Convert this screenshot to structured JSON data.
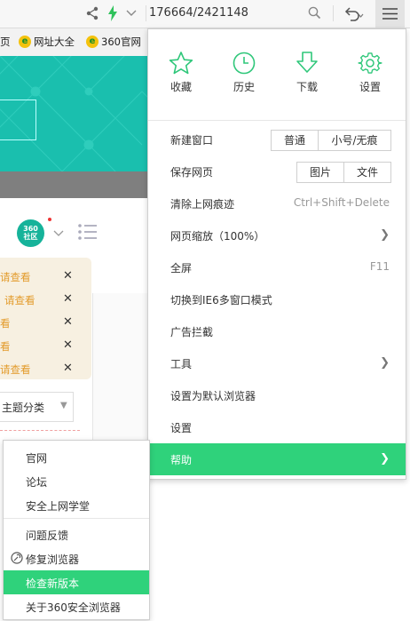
{
  "toolbar": {
    "address_text": "176664/2421148",
    "icons": [
      "share-icon",
      "lightning-icon",
      "chevron-down-icon",
      "search-icon",
      "undo-icon",
      "menu-icon"
    ]
  },
  "bookmarks": [
    {
      "label": "页"
    },
    {
      "label": "网址大全"
    },
    {
      "label": "360官网"
    }
  ],
  "page": {
    "badge_text": "360\n社区",
    "notices": [
      {
        "text": "请查看"
      },
      {
        "text": "请查看"
      },
      {
        "text": "看"
      },
      {
        "text": "看"
      },
      {
        "text": "请查看"
      }
    ],
    "theme_select": "主题分类",
    "accent_color": "#1abfae"
  },
  "menu": {
    "quick_actions": [
      {
        "label": "收藏",
        "icon": "star-icon"
      },
      {
        "label": "历史",
        "icon": "clock-icon"
      },
      {
        "label": "下载",
        "icon": "download-icon"
      },
      {
        "label": "设置",
        "icon": "gear-icon"
      }
    ],
    "items": [
      {
        "label": "新建窗口",
        "buttons": [
          "普通",
          "小号/无痕"
        ]
      },
      {
        "label": "保存网页",
        "buttons": [
          "图片",
          "文件"
        ]
      },
      {
        "label": "清除上网痕迹",
        "shortcut": "Ctrl+Shift+Delete"
      },
      {
        "label": "网页缩放（100%）",
        "has_submenu": true
      },
      {
        "label": "全屏",
        "shortcut": "F11"
      },
      {
        "label": "切换到IE6多窗口模式"
      },
      {
        "label": "广告拦截"
      },
      {
        "label": "工具",
        "has_submenu": true
      },
      {
        "label": "设置为默认浏览器"
      },
      {
        "label": "设置"
      },
      {
        "label": "帮助",
        "has_submenu": true,
        "highlighted": true
      }
    ],
    "highlight_color": "#2fd27b"
  },
  "help_submenu": {
    "items": [
      {
        "label": "官网"
      },
      {
        "label": "论坛"
      },
      {
        "label": "安全上网学堂"
      },
      {
        "label": "问题反馈"
      },
      {
        "label": "修复浏览器",
        "icon": "repair-icon"
      },
      {
        "label": "检查新版本",
        "highlighted": true
      },
      {
        "label": "关于360安全浏览器"
      }
    ]
  }
}
